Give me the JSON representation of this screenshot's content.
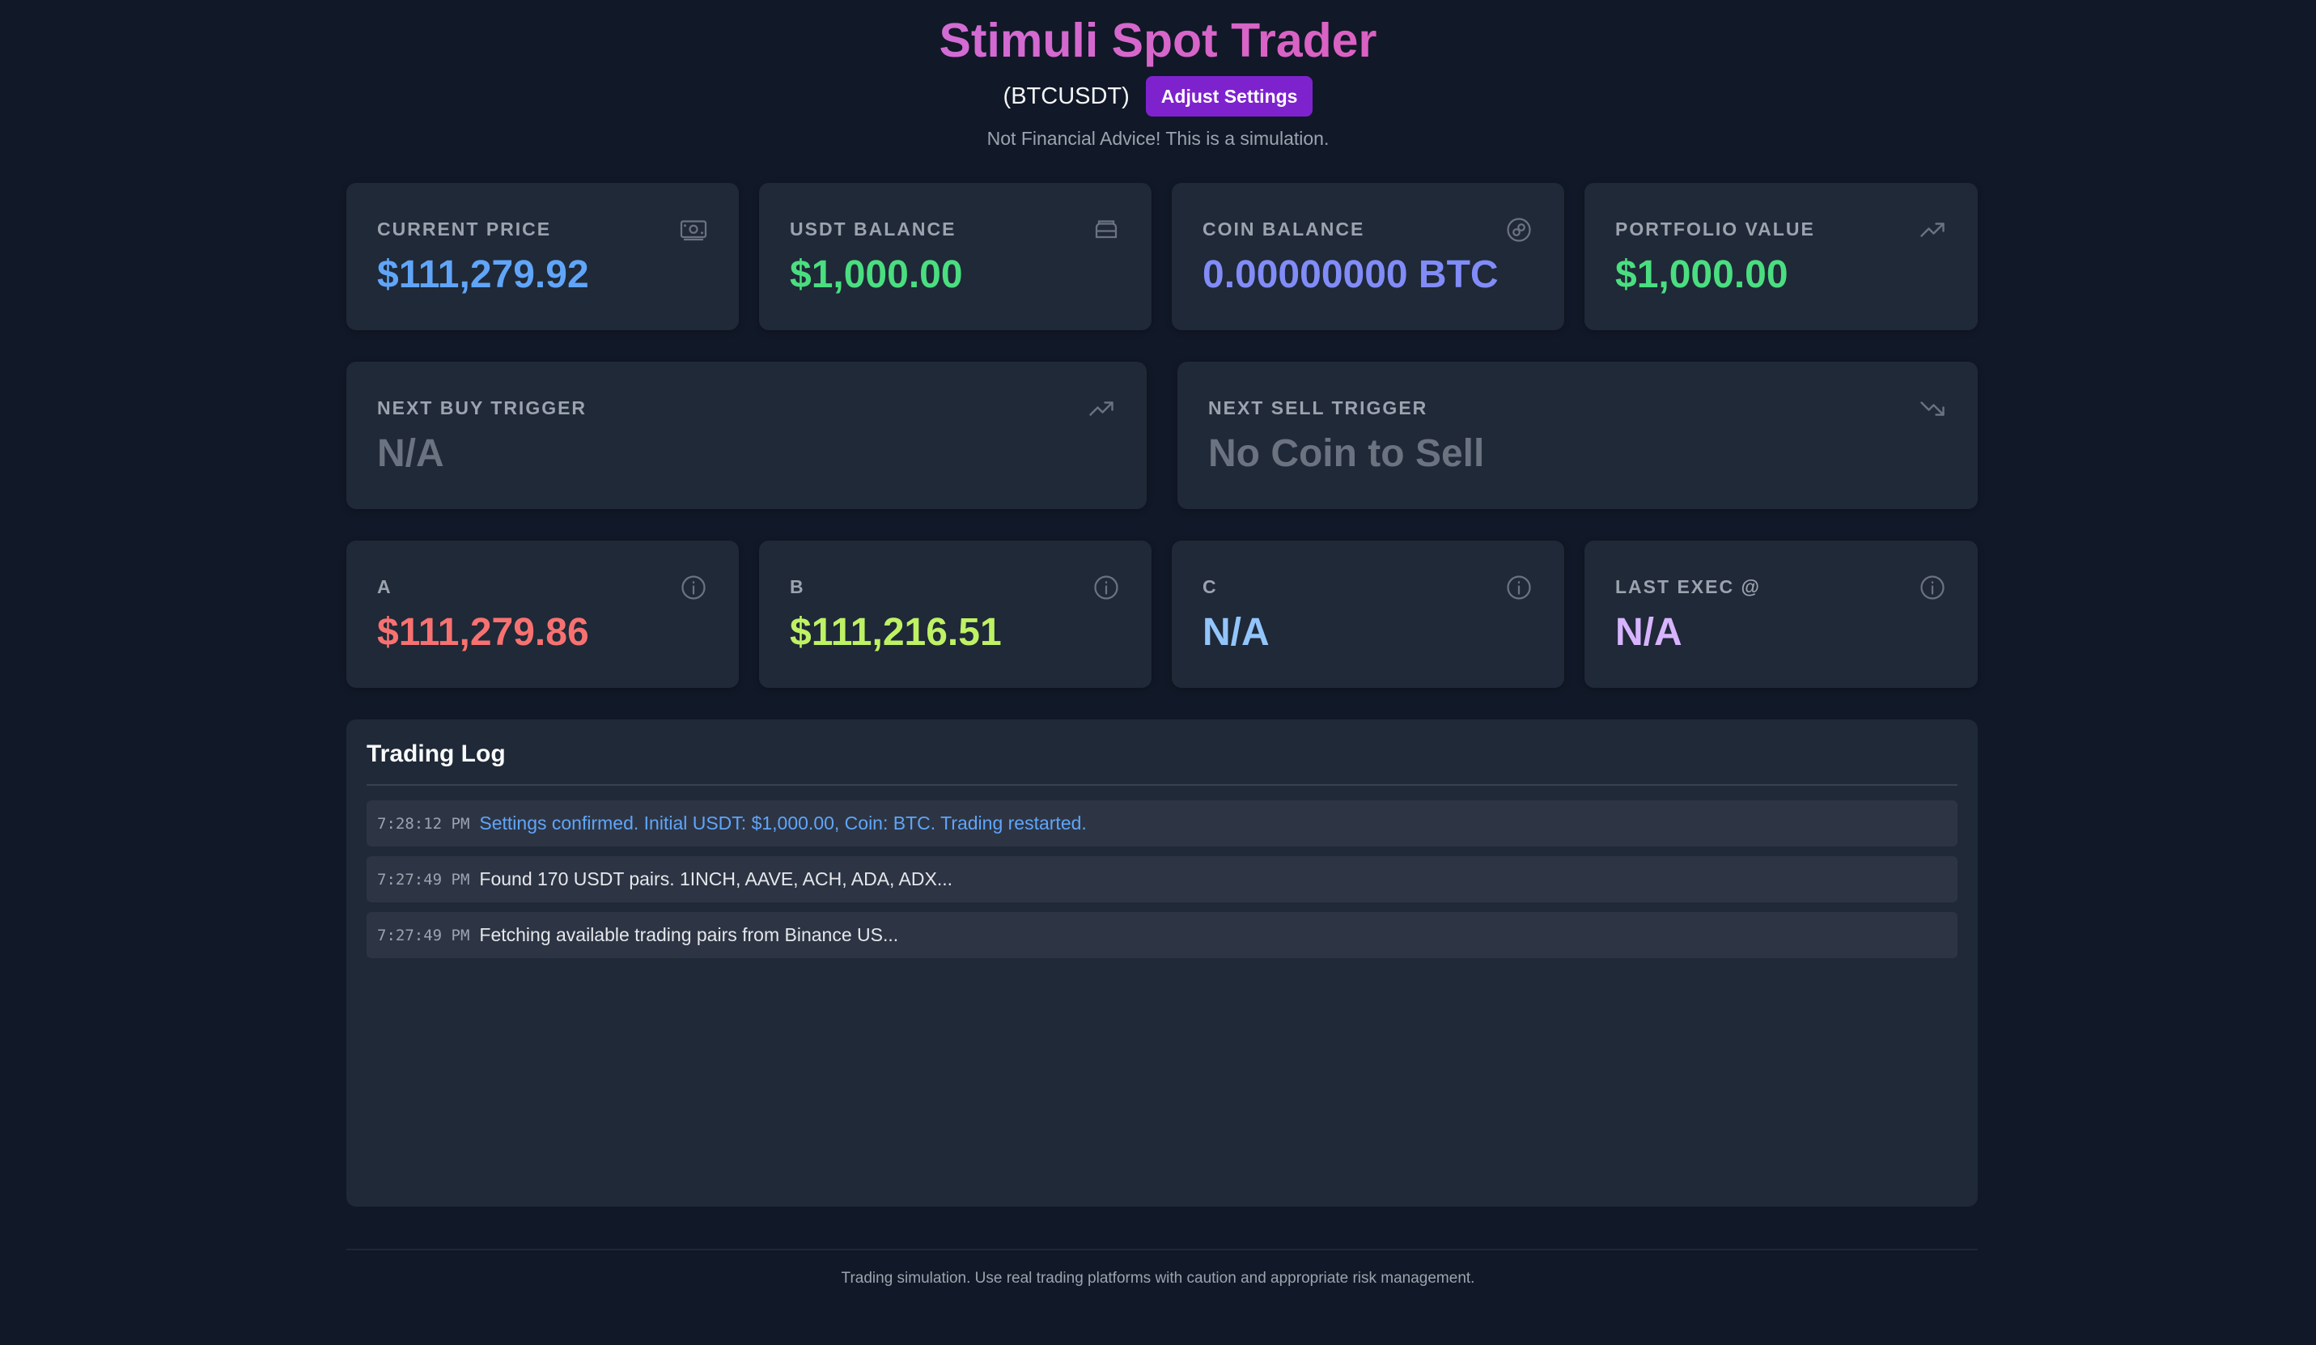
{
  "header": {
    "title": "Stimuli Spot Trader",
    "pair": "(BTCUSDT)",
    "settings_button": "Adjust Settings",
    "disclaimer": "Not Financial Advice! This is a simulation."
  },
  "stats": [
    {
      "label": "Current Price",
      "value": "$111,279.92",
      "icon": "money-icon",
      "color": "#60a5fa"
    },
    {
      "label": "USDT Balance",
      "value": "$1,000.00",
      "icon": "wallet-icon",
      "color": "#4ade80"
    },
    {
      "label": "Coin Balance",
      "value": "0.00000000 BTC",
      "icon": "coin-icon",
      "color": "#818cf8"
    },
    {
      "label": "Portfolio Value",
      "value": "$1,000.00",
      "icon": "trending-up-icon",
      "color": "#4ade80"
    }
  ],
  "triggers": [
    {
      "label": "Next Buy Trigger",
      "value": "N/A",
      "icon": "trending-up-icon",
      "color": "#6b7280"
    },
    {
      "label": "Next Sell Trigger",
      "value": "No Coin to Sell",
      "icon": "trending-down-icon",
      "color": "#6b7280"
    }
  ],
  "levels": [
    {
      "label": "A",
      "value": "$111,279.86",
      "icon": "info-icon",
      "color": "#f87171"
    },
    {
      "label": "B",
      "value": "$111,216.51",
      "icon": "info-icon",
      "color": "#bef264"
    },
    {
      "label": "C",
      "value": "N/A",
      "icon": "info-icon",
      "color": "#93c5fd"
    },
    {
      "label": "Last Exec @",
      "value": "N/A",
      "icon": "info-icon",
      "color": "#d8b4fe"
    }
  ],
  "log": {
    "title": "Trading Log",
    "entries": [
      {
        "time": "7:28:12 PM",
        "message": "Settings confirmed. Initial USDT: $1,000.00, Coin: BTC. Trading restarted.",
        "type": "info"
      },
      {
        "time": "7:27:49 PM",
        "message": "Found 170 USDT pairs. 1INCH, AAVE, ACH, ADA, ADX...",
        "type": "default"
      },
      {
        "time": "7:27:49 PM",
        "message": "Fetching available trading pairs from Binance US...",
        "type": "default"
      }
    ]
  },
  "footer": {
    "text": "Trading simulation. Use real trading platforms with caution and appropriate risk management."
  }
}
